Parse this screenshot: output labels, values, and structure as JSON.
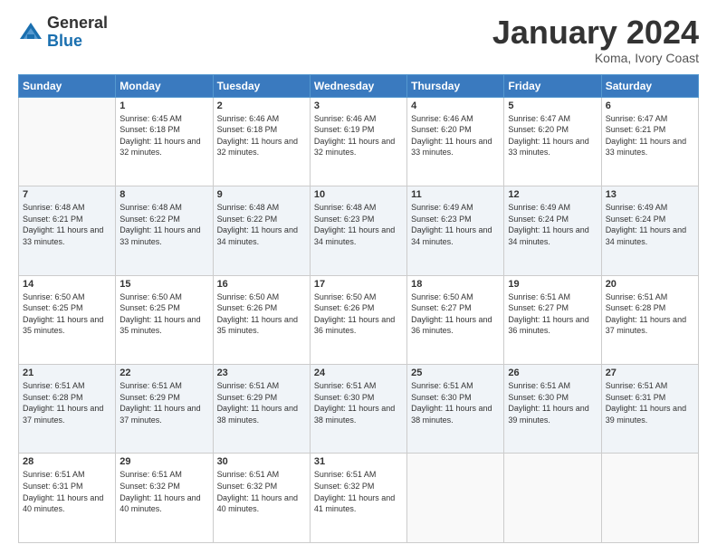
{
  "header": {
    "logo": {
      "general": "General",
      "blue": "Blue"
    },
    "title": "January 2024",
    "subtitle": "Koma, Ivory Coast"
  },
  "weekdays": [
    "Sunday",
    "Monday",
    "Tuesday",
    "Wednesday",
    "Thursday",
    "Friday",
    "Saturday"
  ],
  "weeks": [
    [
      {
        "day": "",
        "sunrise": "",
        "sunset": "",
        "daylight": ""
      },
      {
        "day": "1",
        "sunrise": "Sunrise: 6:45 AM",
        "sunset": "Sunset: 6:18 PM",
        "daylight": "Daylight: 11 hours and 32 minutes."
      },
      {
        "day": "2",
        "sunrise": "Sunrise: 6:46 AM",
        "sunset": "Sunset: 6:18 PM",
        "daylight": "Daylight: 11 hours and 32 minutes."
      },
      {
        "day": "3",
        "sunrise": "Sunrise: 6:46 AM",
        "sunset": "Sunset: 6:19 PM",
        "daylight": "Daylight: 11 hours and 32 minutes."
      },
      {
        "day": "4",
        "sunrise": "Sunrise: 6:46 AM",
        "sunset": "Sunset: 6:20 PM",
        "daylight": "Daylight: 11 hours and 33 minutes."
      },
      {
        "day": "5",
        "sunrise": "Sunrise: 6:47 AM",
        "sunset": "Sunset: 6:20 PM",
        "daylight": "Daylight: 11 hours and 33 minutes."
      },
      {
        "day": "6",
        "sunrise": "Sunrise: 6:47 AM",
        "sunset": "Sunset: 6:21 PM",
        "daylight": "Daylight: 11 hours and 33 minutes."
      }
    ],
    [
      {
        "day": "7",
        "sunrise": "Sunrise: 6:48 AM",
        "sunset": "Sunset: 6:21 PM",
        "daylight": "Daylight: 11 hours and 33 minutes."
      },
      {
        "day": "8",
        "sunrise": "Sunrise: 6:48 AM",
        "sunset": "Sunset: 6:22 PM",
        "daylight": "Daylight: 11 hours and 33 minutes."
      },
      {
        "day": "9",
        "sunrise": "Sunrise: 6:48 AM",
        "sunset": "Sunset: 6:22 PM",
        "daylight": "Daylight: 11 hours and 34 minutes."
      },
      {
        "day": "10",
        "sunrise": "Sunrise: 6:48 AM",
        "sunset": "Sunset: 6:23 PM",
        "daylight": "Daylight: 11 hours and 34 minutes."
      },
      {
        "day": "11",
        "sunrise": "Sunrise: 6:49 AM",
        "sunset": "Sunset: 6:23 PM",
        "daylight": "Daylight: 11 hours and 34 minutes."
      },
      {
        "day": "12",
        "sunrise": "Sunrise: 6:49 AM",
        "sunset": "Sunset: 6:24 PM",
        "daylight": "Daylight: 11 hours and 34 minutes."
      },
      {
        "day": "13",
        "sunrise": "Sunrise: 6:49 AM",
        "sunset": "Sunset: 6:24 PM",
        "daylight": "Daylight: 11 hours and 34 minutes."
      }
    ],
    [
      {
        "day": "14",
        "sunrise": "Sunrise: 6:50 AM",
        "sunset": "Sunset: 6:25 PM",
        "daylight": "Daylight: 11 hours and 35 minutes."
      },
      {
        "day": "15",
        "sunrise": "Sunrise: 6:50 AM",
        "sunset": "Sunset: 6:25 PM",
        "daylight": "Daylight: 11 hours and 35 minutes."
      },
      {
        "day": "16",
        "sunrise": "Sunrise: 6:50 AM",
        "sunset": "Sunset: 6:26 PM",
        "daylight": "Daylight: 11 hours and 35 minutes."
      },
      {
        "day": "17",
        "sunrise": "Sunrise: 6:50 AM",
        "sunset": "Sunset: 6:26 PM",
        "daylight": "Daylight: 11 hours and 36 minutes."
      },
      {
        "day": "18",
        "sunrise": "Sunrise: 6:50 AM",
        "sunset": "Sunset: 6:27 PM",
        "daylight": "Daylight: 11 hours and 36 minutes."
      },
      {
        "day": "19",
        "sunrise": "Sunrise: 6:51 AM",
        "sunset": "Sunset: 6:27 PM",
        "daylight": "Daylight: 11 hours and 36 minutes."
      },
      {
        "day": "20",
        "sunrise": "Sunrise: 6:51 AM",
        "sunset": "Sunset: 6:28 PM",
        "daylight": "Daylight: 11 hours and 37 minutes."
      }
    ],
    [
      {
        "day": "21",
        "sunrise": "Sunrise: 6:51 AM",
        "sunset": "Sunset: 6:28 PM",
        "daylight": "Daylight: 11 hours and 37 minutes."
      },
      {
        "day": "22",
        "sunrise": "Sunrise: 6:51 AM",
        "sunset": "Sunset: 6:29 PM",
        "daylight": "Daylight: 11 hours and 37 minutes."
      },
      {
        "day": "23",
        "sunrise": "Sunrise: 6:51 AM",
        "sunset": "Sunset: 6:29 PM",
        "daylight": "Daylight: 11 hours and 38 minutes."
      },
      {
        "day": "24",
        "sunrise": "Sunrise: 6:51 AM",
        "sunset": "Sunset: 6:30 PM",
        "daylight": "Daylight: 11 hours and 38 minutes."
      },
      {
        "day": "25",
        "sunrise": "Sunrise: 6:51 AM",
        "sunset": "Sunset: 6:30 PM",
        "daylight": "Daylight: 11 hours and 38 minutes."
      },
      {
        "day": "26",
        "sunrise": "Sunrise: 6:51 AM",
        "sunset": "Sunset: 6:30 PM",
        "daylight": "Daylight: 11 hours and 39 minutes."
      },
      {
        "day": "27",
        "sunrise": "Sunrise: 6:51 AM",
        "sunset": "Sunset: 6:31 PM",
        "daylight": "Daylight: 11 hours and 39 minutes."
      }
    ],
    [
      {
        "day": "28",
        "sunrise": "Sunrise: 6:51 AM",
        "sunset": "Sunset: 6:31 PM",
        "daylight": "Daylight: 11 hours and 40 minutes."
      },
      {
        "day": "29",
        "sunrise": "Sunrise: 6:51 AM",
        "sunset": "Sunset: 6:32 PM",
        "daylight": "Daylight: 11 hours and 40 minutes."
      },
      {
        "day": "30",
        "sunrise": "Sunrise: 6:51 AM",
        "sunset": "Sunset: 6:32 PM",
        "daylight": "Daylight: 11 hours and 40 minutes."
      },
      {
        "day": "31",
        "sunrise": "Sunrise: 6:51 AM",
        "sunset": "Sunset: 6:32 PM",
        "daylight": "Daylight: 11 hours and 41 minutes."
      },
      {
        "day": "",
        "sunrise": "",
        "sunset": "",
        "daylight": ""
      },
      {
        "day": "",
        "sunrise": "",
        "sunset": "",
        "daylight": ""
      },
      {
        "day": "",
        "sunrise": "",
        "sunset": "",
        "daylight": ""
      }
    ]
  ]
}
